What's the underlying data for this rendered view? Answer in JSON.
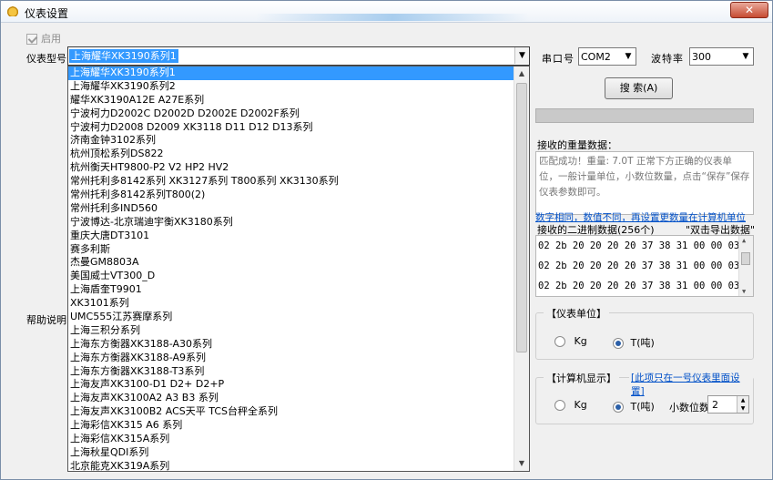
{
  "window": {
    "title": "仪表设置",
    "close_label": "✕"
  },
  "enable": {
    "label": "启用",
    "checked": true,
    "disabled": true
  },
  "meter_type": {
    "label": "仪表型号",
    "selected": "上海耀华XK3190系列1",
    "options": [
      "上海耀华XK3190系列1",
      "上海耀华XK3190系列2",
      "耀华XK3190A12E A27E系列",
      "宁波柯力D2002C D2002D D2002E D2002F系列",
      "宁波柯力D2008 D2009 XK3118 D11 D12 D13系列",
      "济南金钟3102系列",
      "杭州顶松系列DS822",
      "杭州衡天HT9800-P2 V2 HP2 HV2",
      "常州托利多8142系列 XK3127系列 T800系列 XK3130系列",
      "常州托利多8142系列T800(2)",
      "常州托利多IND560",
      "宁波博达-北京瑞迪宇衡XK3180系列",
      "重庆大唐DT3101",
      "赛多利斯",
      "杰曼GM8803A",
      "美国威士VT300_D",
      "上海盾奎T9901",
      "XK3101系列",
      "UMC555江苏赛摩系列",
      "上海三积分系列",
      "上海东方衡器XK3188-A30系列",
      "上海东方衡器XK3188-A9系列",
      "上海东方衡器XK3188-T3系列",
      "上海友声XK3100-D1 D2+ D2+P",
      "上海友声XK3100A2 A3 B3 系列",
      "上海友声XK3100B2 ACS天平 TCS台秤全系列",
      "上海彩信XK315 A6 系列",
      "上海彩信XK315A系列",
      "上海秋星QDI系列",
      "北京能克XK319A系列"
    ]
  },
  "help_label": "帮助说明",
  "serial": {
    "port_label": "串口号",
    "port_value": "COM2",
    "baud_label": "波特率",
    "baud_value": "300"
  },
  "search_button": "搜 索(A)",
  "recv_weight": {
    "label": "接收的重量数据：",
    "hint": "匹配成功！重量: 7.0T  正常下方正确的仪表单位，一般计量单位，小数位数量，点击“保存”保存仪表参数即可。",
    "link_text": "数字相同，数值不同，再设置更数量在计算机单位"
  },
  "recv_binary": {
    "label": "接收的二进制数据(256个)",
    "export_label": "\"双击导出数据\"",
    "lines": [
      "02 2b 20 20 20 20 37 38 31 00 00 03",
      "02 2b 20 20 20 20 37 38 31 00 00 03",
      "02 2b 20 20 20 20 37 38 31 00 00 03"
    ]
  },
  "meter_unit": {
    "title": "仪表单位",
    "opt_kg": "Kg",
    "opt_t": "T(吨)",
    "selected": "T"
  },
  "pc_display": {
    "title": "计算机显示",
    "link": "[此项只在一号仪表里面设置]",
    "opt_kg": "Kg",
    "opt_t": "T(吨)",
    "selected": "T",
    "decimal_label": "小数位数",
    "decimal_value": "2"
  }
}
